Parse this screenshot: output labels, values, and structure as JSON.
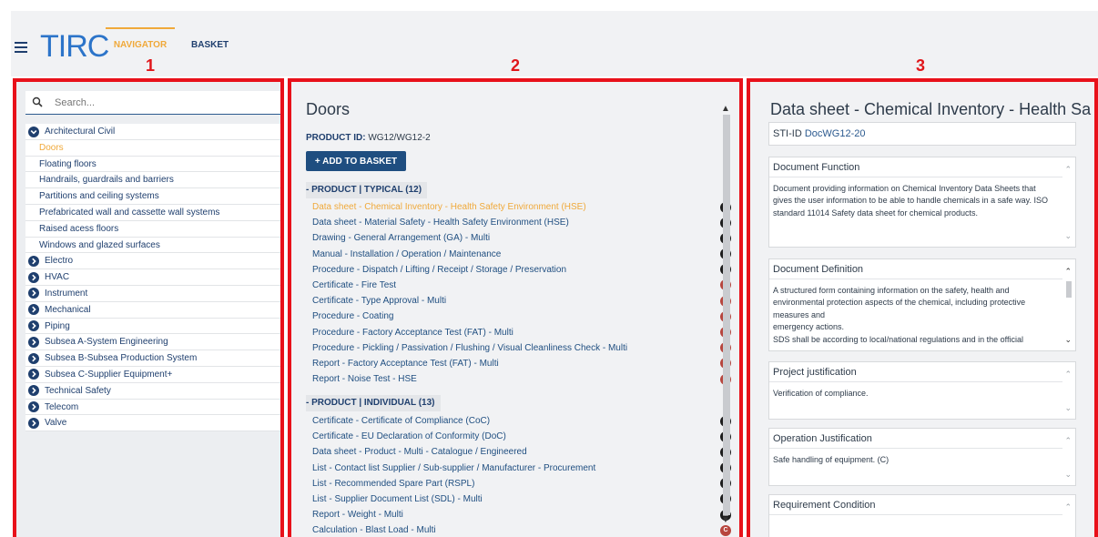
{
  "header": {
    "logo": "TIRC",
    "nav_navigator": "NAVIGATOR",
    "nav_basket": "BASKET",
    "label_1": "1",
    "label_2": "2",
    "label_3": "3"
  },
  "colors": {
    "brand_blue": "#2c74c9",
    "navy": "#1f3f6e",
    "accent_orange": "#f0a93a",
    "annotation_red": "#e8111a"
  },
  "navigator": {
    "search_placeholder": "Search...",
    "tree": [
      {
        "label": "Architectural Civil",
        "type": "cat",
        "expanded": true
      },
      {
        "label": "Doors",
        "type": "sub",
        "active": true
      },
      {
        "label": "Floating floors",
        "type": "sub"
      },
      {
        "label": "Handrails, guardrails and barriers",
        "type": "sub"
      },
      {
        "label": "Partitions and ceiling systems",
        "type": "sub"
      },
      {
        "label": "Prefabricated wall and cassette wall systems",
        "type": "sub"
      },
      {
        "label": "Raised acess floors",
        "type": "sub"
      },
      {
        "label": "Windows and glazed surfaces",
        "type": "sub"
      },
      {
        "label": "Electro",
        "type": "cat"
      },
      {
        "label": "HVAC",
        "type": "cat"
      },
      {
        "label": "Instrument",
        "type": "cat"
      },
      {
        "label": "Mechanical",
        "type": "cat"
      },
      {
        "label": "Piping",
        "type": "cat"
      },
      {
        "label": "Subsea A-System Engineering",
        "type": "cat"
      },
      {
        "label": "Subsea B-Subsea Production System",
        "type": "cat"
      },
      {
        "label": "Subsea C-Supplier Equipment+",
        "type": "cat"
      },
      {
        "label": "Technical Safety",
        "type": "cat"
      },
      {
        "label": "Telecom",
        "type": "cat"
      },
      {
        "label": "Valve",
        "type": "cat"
      }
    ]
  },
  "product": {
    "title": "Doors",
    "product_id_label": "PRODUCT ID:",
    "product_id_value": "WG12/WG12-2",
    "add_button": "+ ADD TO BASKET",
    "typical_header": "- PRODUCT | TYPICAL (12)",
    "typical": [
      {
        "label": "Data sheet - Chemical Inventory - Health Safety Environment (HSE)",
        "badge": "M",
        "highlight": true
      },
      {
        "label": "Data sheet - Material Safety - Health Safety Environment (HSE)",
        "badge": "M"
      },
      {
        "label": "Drawing - General Arrangement (GA) - Multi",
        "badge": "M"
      },
      {
        "label": "Manual - Installation / Operation / Maintenance",
        "badge": "M"
      },
      {
        "label": "Procedure - Dispatch / Lifting / Receipt / Storage / Preservation",
        "badge": "M"
      },
      {
        "label": "Certificate - Fire Test",
        "badge": "C"
      },
      {
        "label": "Certificate - Type Approval - Multi",
        "badge": "C"
      },
      {
        "label": "Procedure - Coating",
        "badge": "C"
      },
      {
        "label": "Procedure - Factory Acceptance Test (FAT) - Multi",
        "badge": "C"
      },
      {
        "label": "Procedure - Pickling / Passivation / Flushing / Visual Cleanliness Check - Multi",
        "badge": "C"
      },
      {
        "label": "Report - Factory Acceptance Test (FAT) - Multi",
        "badge": "C"
      },
      {
        "label": "Report - Noise Test - HSE",
        "badge": "C"
      }
    ],
    "individual_header": "- PRODUCT | INDIVIDUAL (13)",
    "individual": [
      {
        "label": "Certificate - Certificate of Compliance (CoC)",
        "badge": "M"
      },
      {
        "label": "Certificate - EU Declaration of Conformity (DoC)",
        "badge": "M"
      },
      {
        "label": "Data sheet - Product - Multi - Catalogue / Engineered",
        "badge": "M"
      },
      {
        "label": "List - Contact list Supplier / Sub-supplier / Manufacturer - Procurement",
        "badge": "M"
      },
      {
        "label": "List - Recommended Spare Part (RSPL)",
        "badge": "M"
      },
      {
        "label": "List - Supplier Document List (SDL) - Multi",
        "badge": "M"
      },
      {
        "label": "Report - Weight - Multi",
        "badge": "M"
      },
      {
        "label": "Calculation - Blast Load - Multi",
        "badge": "C"
      }
    ]
  },
  "detail": {
    "title": "Data sheet - Chemical Inventory - Health Sa",
    "sti_label": "STI-ID",
    "sti_value": "DocWG12-20",
    "document_function_title": "Document Function",
    "document_function_text": "Document providing information on Chemical Inventory Data Sheets that gives the user information to be able to handle chemicals in a safe way. ISO standard 11014 Safety data sheet for chemical products.",
    "document_definition_title": "Document Definition",
    "document_definition_text": "A structured form containing information on the safety, health and environmental protection aspects of the chemical, including protective measures and",
    "document_definition_text2": "emergency actions.",
    "document_definition_text3": "SDS shall be according to local/national regulations and in the official",
    "project_justification_title": "Project justification",
    "project_justification_text": "Verification of compliance.",
    "operation_justification_title": "Operation Justification",
    "operation_justification_text": "Safe handling of equipment. (C)",
    "requirement_condition_title": "Requirement Condition"
  }
}
